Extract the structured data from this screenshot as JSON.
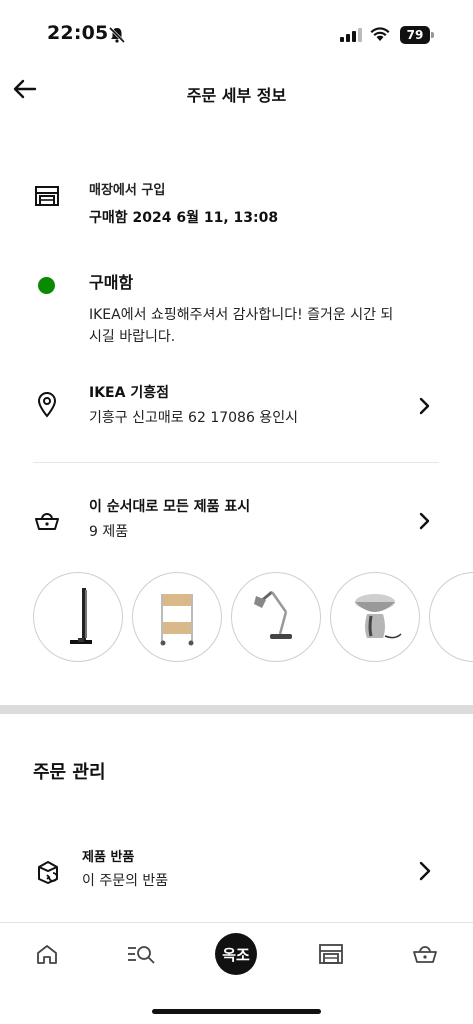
{
  "status_bar": {
    "time": "22:05",
    "battery": "79"
  },
  "header": {
    "title": "주문 세부 정보"
  },
  "purchase": {
    "label": "매장에서 구입",
    "date": "구매함 2024 6월 11, 13:08"
  },
  "order_status": {
    "heading": "구매함",
    "message": "IKEA에서 쇼핑해주셔서 감사합니다! 즐거운 시간 되시길 바랍니다.",
    "color": "#0a8a00"
  },
  "store": {
    "name": "IKEA 기흥점",
    "address": "기흥구 신고매로 62 17086 용인시"
  },
  "products": {
    "title": "이 순서대로 모든 제품 표시",
    "count": "9 제품",
    "thumbnails": [
      "floor-lamp",
      "trolley-cart",
      "desk-lamp",
      "bowl-lamp",
      "partial-item"
    ]
  },
  "manage": {
    "title": "주문 관리"
  },
  "return_item": {
    "title": "제품 반품",
    "subtitle": "이 주문의 반품"
  },
  "bottom_nav": {
    "items": [
      "home-icon",
      "search-list-icon",
      "store-icon",
      "basket-icon"
    ],
    "center_label": "옥조"
  }
}
